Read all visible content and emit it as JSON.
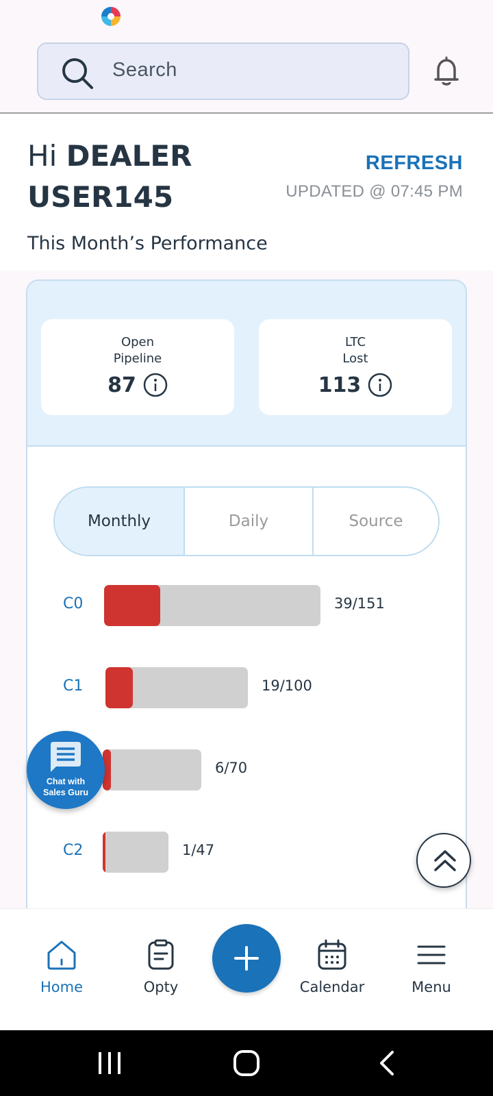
{
  "status_bar": {
    "app_icon": "app-logo-icon"
  },
  "search": {
    "placeholder": "Search",
    "icon": "search-icon"
  },
  "header": {
    "notification_icon": "bell-icon"
  },
  "greeting": {
    "hi": "Hi ",
    "name": "DEALER USER145"
  },
  "refresh": {
    "label": "REFRESH",
    "updated": "UPDATED @ 07:45 PM"
  },
  "section_title": "This Month’s Performance",
  "stats": [
    {
      "label_line1": "Open",
      "label_line2": "Pipeline",
      "value": "87",
      "icon": "info-icon"
    },
    {
      "label_line1": "LTC",
      "label_line2": "Lost",
      "value": "113",
      "icon": "info-icon"
    }
  ],
  "tabs": [
    {
      "label": "Monthly",
      "active": true
    },
    {
      "label": "Daily",
      "active": false
    },
    {
      "label": "Source",
      "active": false
    }
  ],
  "funnel": [
    {
      "label": "C0",
      "value": "39/151",
      "done": 39,
      "total": 151
    },
    {
      "label": "C1",
      "value": "19/100",
      "done": 19,
      "total": 100
    },
    {
      "label": "",
      "value": "6/70",
      "done": 6,
      "total": 70
    },
    {
      "label": "C2",
      "value": "1/47",
      "done": 1,
      "total": 47
    }
  ],
  "chat": {
    "line1": "Chat with",
    "line2": "Sales Guru",
    "icon": "chat-icon"
  },
  "scroll_top": {
    "icon": "chevron-double-up-icon"
  },
  "bottom_nav": {
    "home": "Home",
    "opty": "Opty",
    "add_icon": "plus-icon",
    "calendar": "Calendar",
    "menu": "Menu"
  },
  "colors": {
    "accent": "#1a72b8",
    "bar_fill": "#cf3430",
    "bar_track": "#d0d0d0",
    "panel": "#e3f1fc"
  }
}
